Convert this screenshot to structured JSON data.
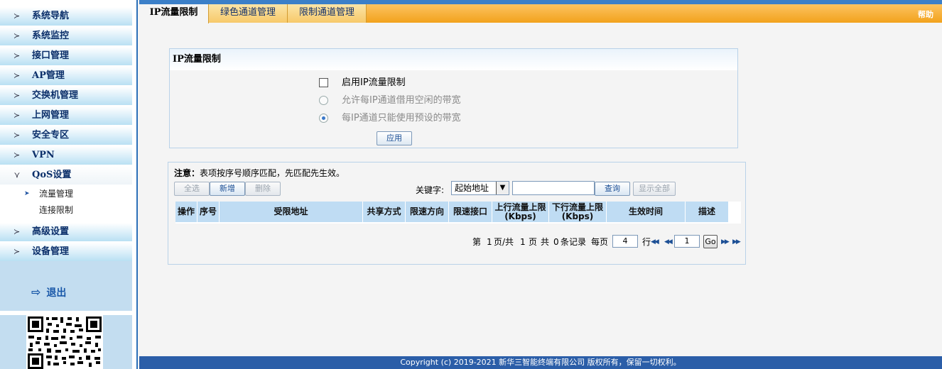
{
  "sidebar": {
    "menu": [
      {
        "label": "系统导航"
      },
      {
        "label": "系统监控"
      },
      {
        "label": "接口管理"
      },
      {
        "label": "AP管理"
      },
      {
        "label": "交换机管理"
      },
      {
        "label": "上网管理"
      },
      {
        "label": "安全专区"
      },
      {
        "label": "VPN"
      },
      {
        "label": "QoS设置"
      },
      {
        "label": "高级设置"
      },
      {
        "label": "设备管理"
      }
    ],
    "qos_submenu": [
      {
        "label": "流量管理"
      },
      {
        "label": "连接限制"
      }
    ],
    "logout_label": "退出"
  },
  "tabs": [
    {
      "label": "IP流量限制",
      "active": true
    },
    {
      "label": "绿色通道管理",
      "active": false
    },
    {
      "label": "限制通道管理",
      "active": false
    }
  ],
  "help_label": "帮助",
  "ip_limit": {
    "title": "IP流量限制",
    "enable_label": "启用IP流量限制",
    "enable_checked": false,
    "option_borrow_label": "允许每IP通道借用空闲的带宽",
    "option_preset_label": "每IP通道只能使用预设的带宽",
    "selected_option": "preset",
    "apply_label": "应用"
  },
  "rules": {
    "note_prefix": "注意：",
    "note_text": "表项按序号顺序匹配，先匹配先生效。",
    "buttons": {
      "select_all": "全选",
      "add": "新增",
      "delete": "删除"
    },
    "keyword_label": "关键字:",
    "keyword_value": "起始地址",
    "search_value": "",
    "query_label": "查询",
    "show_all_label": "显示全部",
    "columns": [
      {
        "label": "操作"
      },
      {
        "label": "序号"
      },
      {
        "label": "受限地址"
      },
      {
        "label": "共享方式"
      },
      {
        "label": "限速方向"
      },
      {
        "label": "限速接口"
      },
      {
        "label": "上行流量上限\n(Kbps)"
      },
      {
        "label": "下行流量上限\n(Kbps)"
      },
      {
        "label": "生效时间"
      },
      {
        "label": "描述"
      }
    ],
    "rows": []
  },
  "pager": {
    "page_prefix": "第",
    "current_page": "1",
    "page_mid": "页/共",
    "total_pages": "1",
    "page_word": "页",
    "total_word": "共",
    "record_count": "0",
    "record_word": "条记录",
    "per_page_label": "每页",
    "per_page_value": "4",
    "rows_word": "行",
    "goto_value": "1",
    "go_label": "Go"
  },
  "footer": "Copyright (c) 2019-2021 新华三智能终端有限公司 版权所有，保留一切权利。"
}
